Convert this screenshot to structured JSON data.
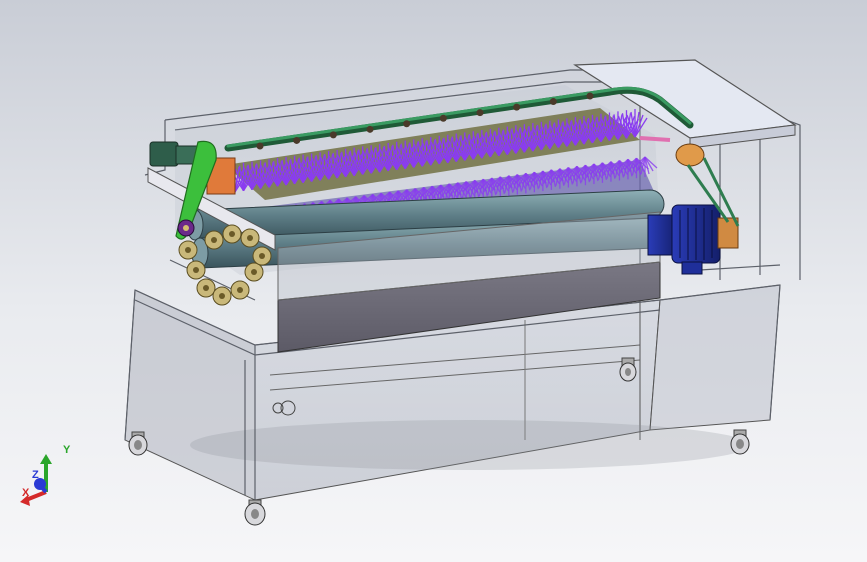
{
  "viewport": {
    "model": "brush-washing-machine-assembly",
    "background_top": "#c9cdd6",
    "background_bottom": "#f6f6f8"
  },
  "colors": {
    "brushes": "#8a3cf0",
    "motor": "#1f2f9a",
    "pipe": "#2e7d4f",
    "belt": "#3cbf3c",
    "rollers": "#5f7f88",
    "frame": "#6b6f78",
    "panel": "#6e6c78",
    "pulley": "#e09a4a",
    "tray": "#e4e8f2"
  },
  "triad": {
    "x_label": "X",
    "y_label": "Y",
    "z_label": "Z",
    "x_color": "#d42a2a",
    "y_color": "#2aa52a",
    "z_color": "#2a3ad4"
  }
}
